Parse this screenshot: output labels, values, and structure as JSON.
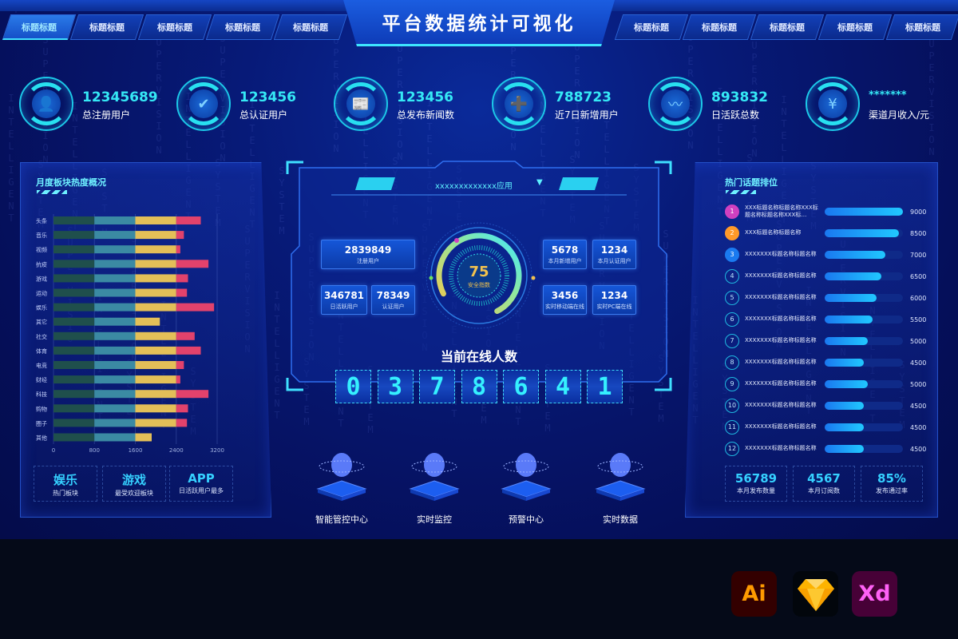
{
  "header": {
    "title": "平台数据统计可视化",
    "left_tabs": [
      {
        "label": "标题标题",
        "active": true
      },
      {
        "label": "标题标题"
      },
      {
        "label": "标题标题"
      },
      {
        "label": "标题标题"
      },
      {
        "label": "标题标题"
      }
    ],
    "right_tabs": [
      {
        "label": "标题标题"
      },
      {
        "label": "标题标题"
      },
      {
        "label": "标题标题"
      },
      {
        "label": "标题标题"
      },
      {
        "label": "标题标题"
      }
    ]
  },
  "background_words": [
    "SYSTEM",
    "SUPERVISION",
    "INTELLIGENT"
  ],
  "kpis": [
    {
      "value": "12345689",
      "label": "总注册用户",
      "icon": "user-icon",
      "glyph": "👤"
    },
    {
      "value": "123456",
      "label": "总认证用户",
      "icon": "verified-user-icon",
      "glyph": "✔"
    },
    {
      "value": "123456",
      "label": "总发布新闻数",
      "icon": "news-icon",
      "glyph": "📰"
    },
    {
      "value": "788723",
      "label": "近7日新增用户",
      "icon": "add-user-icon",
      "glyph": "➕"
    },
    {
      "value": "893832",
      "label": "日活跃总数",
      "icon": "pulse-icon",
      "glyph": "〰"
    },
    {
      "value": "*******",
      "label": "渠道月收入/元",
      "icon": "money-bag-icon",
      "glyph": "¥"
    }
  ],
  "left_panel": {
    "title": "月度板块热度概况",
    "summary": [
      {
        "value": "娱乐",
        "label": "热门板块"
      },
      {
        "value": "游戏",
        "label": "最受欢迎板块"
      },
      {
        "value": "APP",
        "label": "日活跃用户最多"
      }
    ]
  },
  "chart_data": {
    "type": "bar",
    "orientation": "horizontal-stacked",
    "categories": [
      "头条",
      "音乐",
      "视频",
      "抗疫",
      "游戏",
      "运动",
      "娱乐",
      "其它",
      "社交",
      "体育",
      "电竞",
      "财经",
      "科技",
      "购物",
      "圈子",
      "其他"
    ],
    "series": [
      {
        "values": [
          800,
          800,
          800,
          800,
          800,
          800,
          800,
          800,
          800,
          800,
          800,
          800,
          800,
          800,
          800,
          800
        ],
        "color": "#1f4f4c"
      },
      {
        "values": [
          800,
          800,
          800,
          800,
          800,
          800,
          800,
          800,
          800,
          800,
          800,
          800,
          800,
          800,
          800,
          800
        ],
        "color": "#3b8aa3"
      },
      {
        "values": [
          800,
          800,
          800,
          800,
          800,
          800,
          800,
          480,
          800,
          800,
          800,
          800,
          800,
          800,
          800,
          320
        ],
        "color": "#e3bf58"
      },
      {
        "values": [
          480,
          150,
          80,
          630,
          230,
          210,
          740,
          0,
          360,
          480,
          150,
          80,
          630,
          230,
          210,
          0
        ],
        "color": "#e2426c"
      }
    ],
    "xticks": [
      "0",
      "800",
      "1600",
      "2400",
      "3200"
    ],
    "xlim": [
      0,
      3200
    ],
    "grid": true
  },
  "center": {
    "app_select": "xxxxxxxxxxxxx应用",
    "left_stats": [
      {
        "value": "2839849",
        "label": "注册用户"
      },
      {
        "value": "346781",
        "label": "日活跃用户"
      },
      {
        "value": "78349",
        "label": "认证用户"
      }
    ],
    "right_stats": [
      {
        "value": "5678",
        "label": "本月新增用户"
      },
      {
        "value": "1234",
        "label": "本月认证用户"
      },
      {
        "value": "3456",
        "label": "实时移动端在线"
      },
      {
        "value": "1234",
        "label": "实时PC端在线"
      }
    ],
    "gauge": {
      "value": "75",
      "label": "安全指数",
      "percent": 75
    },
    "online_title": "当前在线人数",
    "online_digits": [
      "0",
      "3",
      "7",
      "8",
      "6",
      "4",
      "1"
    ]
  },
  "modules": [
    {
      "label": "智能管控中心",
      "icon": "robot-head-icon"
    },
    {
      "label": "实时监控",
      "icon": "monitor-globe-icon"
    },
    {
      "label": "预警中心",
      "icon": "shield-alert-icon"
    },
    {
      "label": "实时数据",
      "icon": "data-funnel-icon"
    }
  ],
  "right_panel": {
    "title": "热门话题排位",
    "max": 9000,
    "items": [
      {
        "rank": "1",
        "text": "XXX标题名称标题名称XXX标题名称标题名称XXX标…",
        "value": 9000
      },
      {
        "rank": "2",
        "text": "XXX标题名称标题名称",
        "value": 8500
      },
      {
        "rank": "3",
        "text": "XXXXXXX标题名称标题名称",
        "value": 7000
      },
      {
        "rank": "4",
        "text": "XXXXXXX标题名称标题名称",
        "value": 6500
      },
      {
        "rank": "5",
        "text": "XXXXXXX标题名称标题名称",
        "value": 6000
      },
      {
        "rank": "6",
        "text": "XXXXXXX标题名称标题名称",
        "value": 5500
      },
      {
        "rank": "7",
        "text": "XXXXXXX标题名称标题名称",
        "value": 5000
      },
      {
        "rank": "8",
        "text": "XXXXXXX标题名称标题名称",
        "value": 4500
      },
      {
        "rank": "9",
        "text": "XXXXXXX标题名称标题名称",
        "value": 5000
      },
      {
        "rank": "10",
        "text": "XXXXXXX标题名称标题名称",
        "value": 4500
      },
      {
        "rank": "11",
        "text": "XXXXXXX标题名称标题名称",
        "value": 4500
      },
      {
        "rank": "12",
        "text": "XXXXXXX标题名称标题名称",
        "value": 4500
      }
    ],
    "rank_colors": [
      "#d040c0",
      "#ff9a2a",
      "#1a7af0"
    ],
    "summary": [
      {
        "value": "56789",
        "label": "本月发布数量"
      },
      {
        "value": "4567",
        "label": "本月订阅数"
      },
      {
        "value": "85%",
        "label": "发布通过率"
      }
    ]
  },
  "logos": [
    {
      "label": "Ai",
      "name": "illustrator-logo"
    },
    {
      "label": "",
      "name": "sketch-logo"
    },
    {
      "label": "Xd",
      "name": "xd-logo"
    }
  ]
}
